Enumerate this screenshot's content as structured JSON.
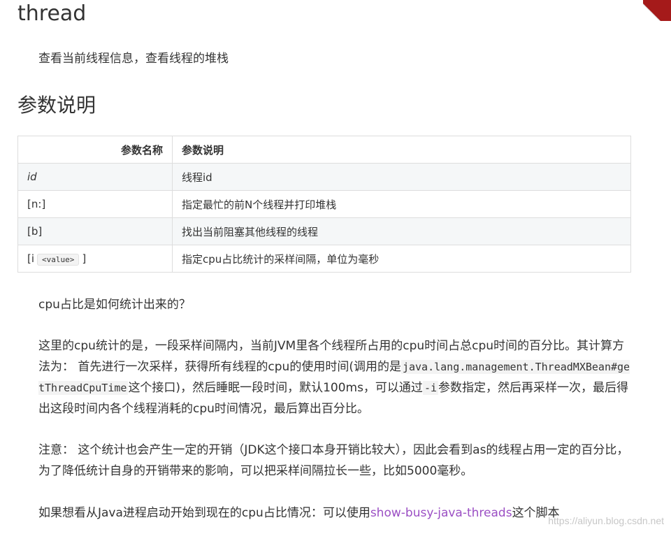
{
  "doc": {
    "title": "thread",
    "intro": "查看当前线程信息，查看线程的堆栈",
    "section_title": "参数说明"
  },
  "table": {
    "headers": [
      "参数名称",
      "参数说明"
    ],
    "rows": [
      {
        "name": "id",
        "desc": "线程id"
      },
      {
        "name": "[n:]",
        "desc": "指定最忙的前N个线程并打印堆栈"
      },
      {
        "name": "[b]",
        "desc": "找出当前阻塞其他线程的线程"
      },
      {
        "name_prefix": "[i",
        "name_code": "<value>",
        "name_suffix": "]",
        "desc": "指定cpu占比统计的采样间隔，单位为毫秒"
      }
    ]
  },
  "paragraphs": {
    "p1": "cpu占比是如何统计出来的？",
    "p2_a": "这里的cpu统计的是，一段采样间隔内，当前JVM里各个线程所占用的cpu时间占总cpu时间的百分比。其计算方法为： 首先进行一次采样，获得所有线程的cpu的使用时间(调用的是",
    "p2_code1": "java.lang.management.ThreadMXBean#getThreadCpuTime",
    "p2_b": "这个接口)，然后睡眠一段时间，默认100ms，可以通过",
    "p2_code2": "-i",
    "p2_c": "参数指定，然后再采样一次，最后得出这段时间内各个线程消耗的cpu时间情况，最后算出百分比。",
    "p3": "注意： 这个统计也会产生一定的开销（JDK这个接口本身开销比较大），因此会看到as的线程占用一定的百分比，为了降低统计自身的开销带来的影响，可以把采样间隔拉长一些，比如5000毫秒。",
    "p4_a": "如果想看从Java进程启动开始到现在的cpu占比情况：可以使用",
    "p4_link": "show-busy-java-threads",
    "p4_b": "这个脚本"
  },
  "watermark": "https://aliyun.blog.csdn.net",
  "colors": {
    "link": "#9b4fc4",
    "ribbon": "#a51a1a",
    "table_stripe": "#f5f7f8"
  }
}
